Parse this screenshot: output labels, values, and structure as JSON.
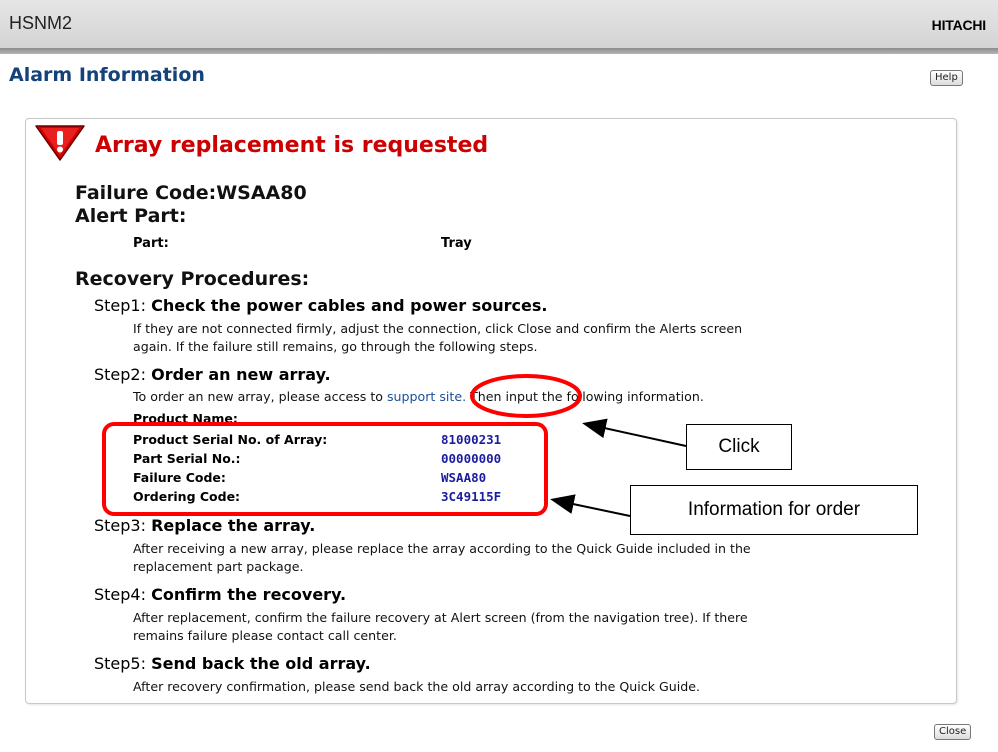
{
  "header": {
    "app_name": "HSNM2",
    "brand": "HITACHI",
    "page_title": "Alarm Information",
    "help_label": "Help"
  },
  "alert": {
    "icon": "alert-exclamation-icon",
    "title": "Array replacement is requested",
    "failure_code_line": "Failure Code:WSAA80",
    "alert_part_heading": "Alert Part:",
    "part_label": "Part:",
    "part_value": "Tray",
    "recovery_heading": "Recovery Procedures:"
  },
  "steps": [
    {
      "prefix": "Step1: ",
      "title": "Check the power cables and power sources.",
      "text1": "If they are not connected firmly, adjust the connection, click Close and confirm the Alerts screen",
      "text2": "again. If the failure still remains, go through the following steps."
    },
    {
      "prefix": "Step2: ",
      "title": "Order an new array.",
      "text_before": "To order an new array, please access to ",
      "link": "support site.",
      "text_after": " Then input the following information."
    },
    {
      "prefix": "Step3: ",
      "title": "Replace the array.",
      "text1": "After receiving a new array, please replace the array according to the Quick Guide included in the",
      "text2": "replacement part package."
    },
    {
      "prefix": "Step4: ",
      "title": "Confirm the recovery.",
      "text1": "After replacement, confirm the failure recovery at Alert screen (from the navigation tree). If there",
      "text2": "remains failure please contact call center."
    },
    {
      "prefix": "Step5: ",
      "title": "Send back the old array.",
      "text1": "After recovery confirmation, please send back the old array according to the Quick Guide."
    }
  ],
  "order_info": {
    "product_name_label": "Product Name:",
    "rows": [
      {
        "label": "Product Serial No. of Array:",
        "value": "81000231"
      },
      {
        "label": "Part Serial No.:",
        "value": "00000000"
      },
      {
        "label": "Failure Code:",
        "value": "WSAA80"
      },
      {
        "label": "Ordering Code:",
        "value": "3C49115F"
      }
    ]
  },
  "annotations": {
    "click": "Click",
    "info": "Information for order",
    "highlight_color": "#ff0000"
  },
  "footer": {
    "close_label": "Close"
  },
  "colors": {
    "title_blue": "#14427a",
    "alert_red": "#cc0000",
    "value_blue": "#1c1c9e",
    "link_blue": "#1a4f9c"
  }
}
